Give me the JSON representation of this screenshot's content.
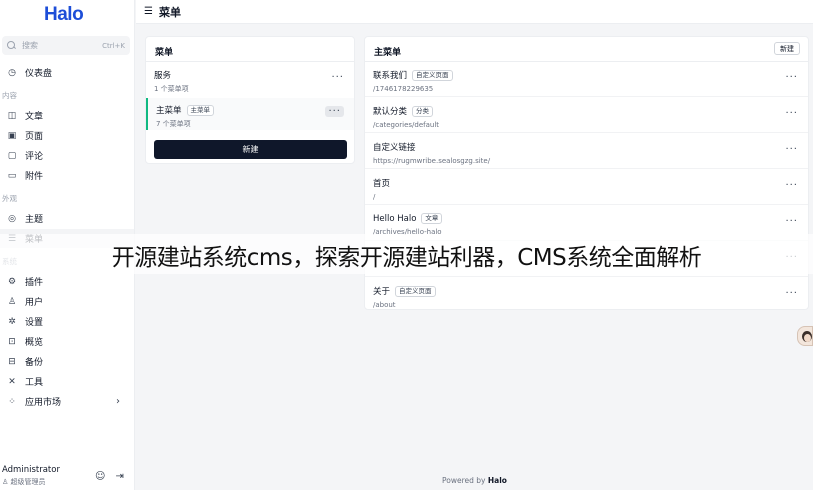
{
  "sidebar": {
    "logo": "Halo",
    "search": {
      "placeholder": "搜索",
      "shortcut": "Ctrl+K"
    },
    "dashboard": {
      "label": "仪表盘",
      "icon": "dashboard-icon"
    },
    "group_content": "内容",
    "content_items": [
      {
        "label": "文章",
        "icon": "article-icon"
      },
      {
        "label": "页面",
        "icon": "page-icon"
      },
      {
        "label": "评论",
        "icon": "comment-icon"
      },
      {
        "label": "附件",
        "icon": "folder-icon"
      }
    ],
    "group_appearance": "外观",
    "appearance_items": [
      {
        "label": "主题",
        "icon": "palette-icon"
      },
      {
        "label": "菜单",
        "icon": "menu-list-icon"
      }
    ],
    "group_system": "系统",
    "system_items": [
      {
        "label": "插件",
        "icon": "plugin-icon"
      },
      {
        "label": "用户",
        "icon": "user-icon"
      },
      {
        "label": "设置",
        "icon": "gear-icon"
      },
      {
        "label": "概览",
        "icon": "terminal-icon"
      },
      {
        "label": "备份",
        "icon": "backup-icon"
      },
      {
        "label": "工具",
        "icon": "tools-icon"
      },
      {
        "label": "应用市场",
        "icon": "app-store-icon"
      }
    ],
    "user": {
      "name": "Administrator",
      "role": "超级管理员"
    }
  },
  "header": {
    "title": "菜单"
  },
  "menus_panel": {
    "title": "菜单",
    "items": [
      {
        "name": "服务",
        "sub": "1 个菜单项",
        "tag": ""
      },
      {
        "name": "主菜单",
        "sub": "7 个菜单项",
        "tag": "主菜单"
      }
    ],
    "new_label": "新建"
  },
  "menu_items_panel": {
    "title": "主菜单",
    "new_label": "新建",
    "items": [
      {
        "name": "联系我们",
        "tag": "自定义页面",
        "path": "/1746178229635"
      },
      {
        "name": "默认分类",
        "tag": "分类",
        "path": "/categories/default"
      },
      {
        "name": "自定义链接",
        "tag": "",
        "path": "https://rugmwribe.sealosgzg.site/"
      },
      {
        "name": "首页",
        "tag": "",
        "path": "/"
      },
      {
        "name": "Hello Halo",
        "tag": "文章",
        "path": "/archives/hello-halo"
      },
      {
        "name": "",
        "tag": "",
        "path": ""
      },
      {
        "name": "关于",
        "tag": "自定义页面",
        "path": "/about"
      }
    ]
  },
  "overlay_caption": "开源建站系统cms，探索开源建站利器，CMS系统全面解析",
  "footer": {
    "prefix": "Powered by ",
    "brand": "Halo"
  }
}
